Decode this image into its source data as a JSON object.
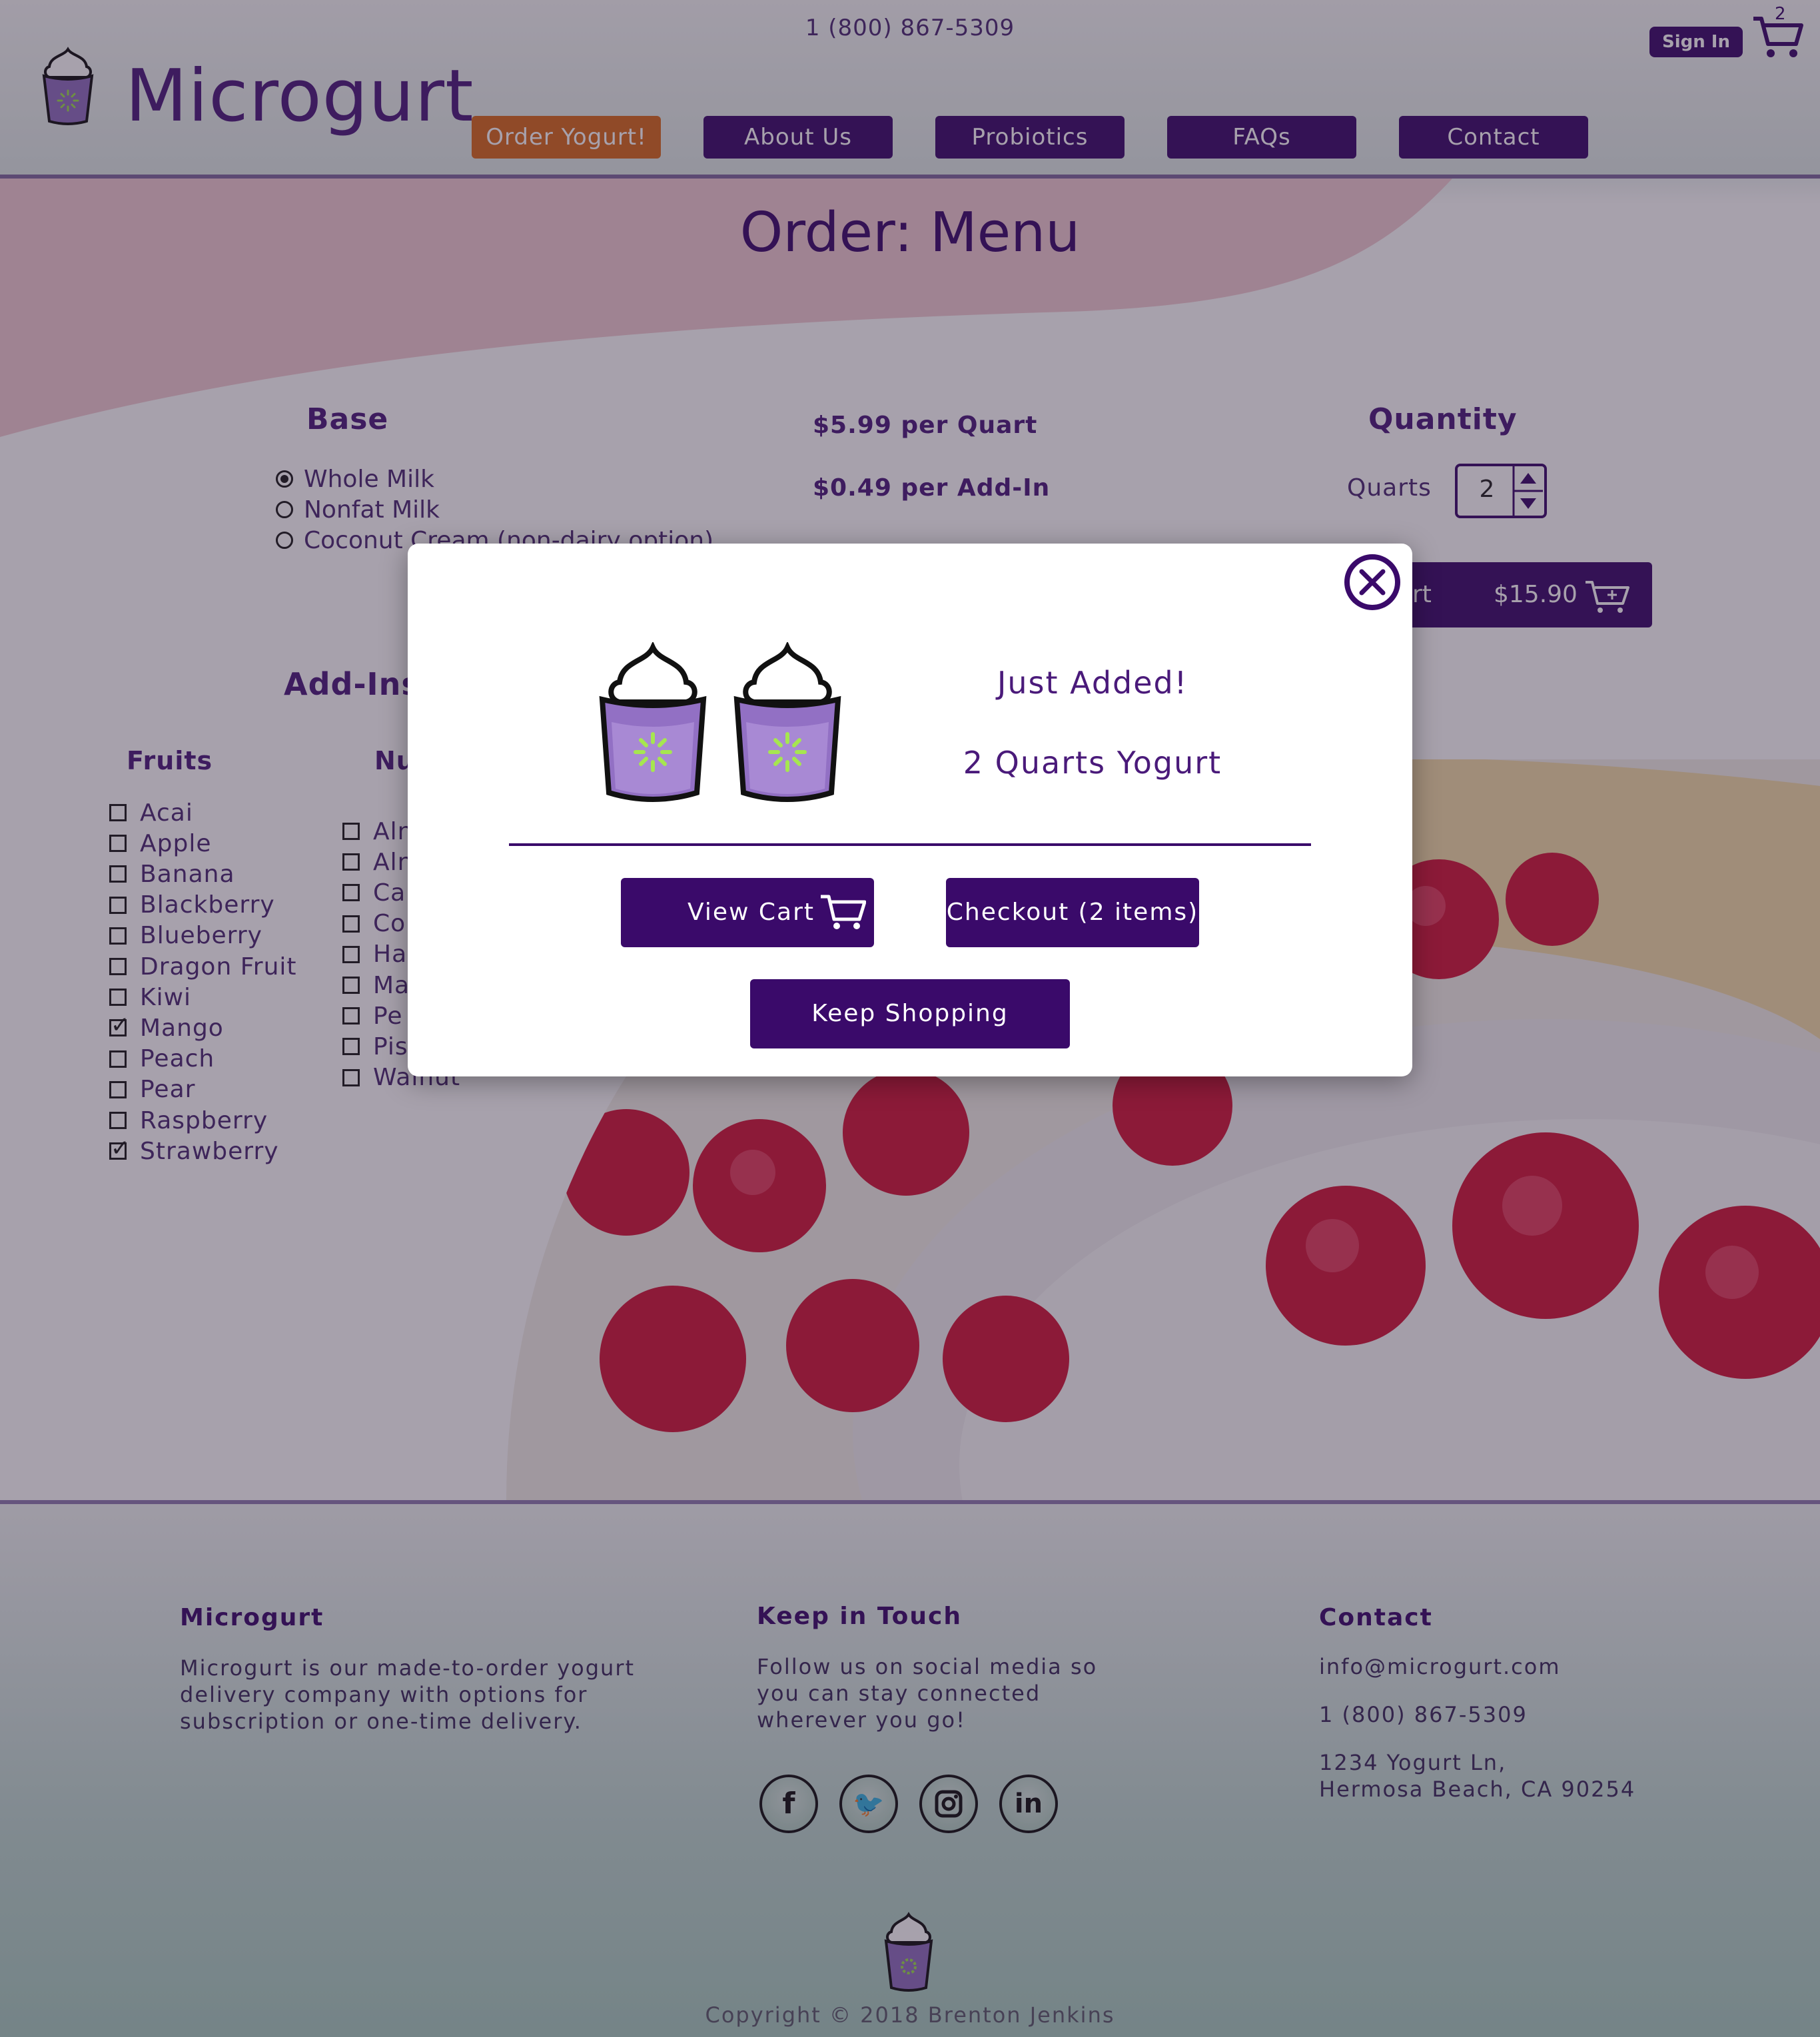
{
  "header": {
    "phone": "1 (800) 867-5309",
    "brand": "Microgurt",
    "signin_label": "Sign In",
    "cart_count": "2",
    "nav": [
      {
        "label": "Order Yogurt!",
        "active": true
      },
      {
        "label": "About Us"
      },
      {
        "label": "Probiotics"
      },
      {
        "label": "FAQs"
      },
      {
        "label": "Contact"
      }
    ]
  },
  "order": {
    "title": "Order: Menu",
    "base_title": "Base",
    "base_options": [
      {
        "label": "Whole Milk",
        "selected": true
      },
      {
        "label": "Nonfat Milk",
        "selected": false
      },
      {
        "label": "Coconut Cream (non-dairy option)",
        "selected": false
      }
    ],
    "price_quart": "$5.99 per Quart",
    "price_addin": "$0.49 per Add-In",
    "quantity_title": "Quantity",
    "quantity_label": "Quarts",
    "quantity_value": "2",
    "add_to_cart_label": "rt",
    "add_to_cart_total": "$15.90",
    "addins_title": "Add-Ins",
    "fruits_title": "Fruits",
    "fruits": [
      {
        "label": "Acai",
        "checked": false
      },
      {
        "label": "Apple",
        "checked": false
      },
      {
        "label": "Banana",
        "checked": false
      },
      {
        "label": "Blackberry",
        "checked": false
      },
      {
        "label": "Blueberry",
        "checked": false
      },
      {
        "label": "Dragon Fruit",
        "checked": false
      },
      {
        "label": "Kiwi",
        "checked": false
      },
      {
        "label": "Mango",
        "checked": true
      },
      {
        "label": "Peach",
        "checked": false
      },
      {
        "label": "Pear",
        "checked": false
      },
      {
        "label": "Raspberry",
        "checked": false
      },
      {
        "label": "Strawberry",
        "checked": true
      }
    ],
    "nuts_title": "Nu",
    "nuts": [
      {
        "label": "Aln",
        "checked": false
      },
      {
        "label": "Aln",
        "checked": false
      },
      {
        "label": "Ca",
        "checked": false
      },
      {
        "label": "Co",
        "checked": false
      },
      {
        "label": "Ha",
        "checked": false
      },
      {
        "label": "Ma",
        "checked": false
      },
      {
        "label": "Pe",
        "checked": false
      },
      {
        "label": "Pis",
        "checked": false
      },
      {
        "label": "Walnut",
        "checked": false
      }
    ]
  },
  "modal": {
    "just_added": "Just Added!",
    "item_summary": "2 Quarts Yogurt",
    "view_cart_label": "View Cart",
    "checkout_label": "Checkout (2 items)",
    "keep_shopping_label": "Keep Shopping",
    "close_icon": "close-circle-icon"
  },
  "footer": {
    "about_title": "Microgurt",
    "about_text": "Microgurt is our made-to-order yogurt delivery company with options for subscription or one-time delivery.",
    "social_title": "Keep in Touch",
    "social_text": "Follow us on social media so you can stay connected wherever you go!",
    "social_icons": [
      "facebook-icon",
      "twitter-icon",
      "instagram-icon",
      "linkedin-icon"
    ],
    "contact_title": "Contact",
    "email": "info@microgurt.com",
    "phone": "1 (800) 867-5309",
    "address_line1": "1234 Yogurt Ln,",
    "address_line2": "Hermosa Beach, CA 90254",
    "copyright": "Copyright © 2018 Brenton Jenkins"
  },
  "colors": {
    "brand_purple": "#3a0a6a",
    "accent_orange": "#d76a1c",
    "wave_pink": "#f2ccd2"
  }
}
